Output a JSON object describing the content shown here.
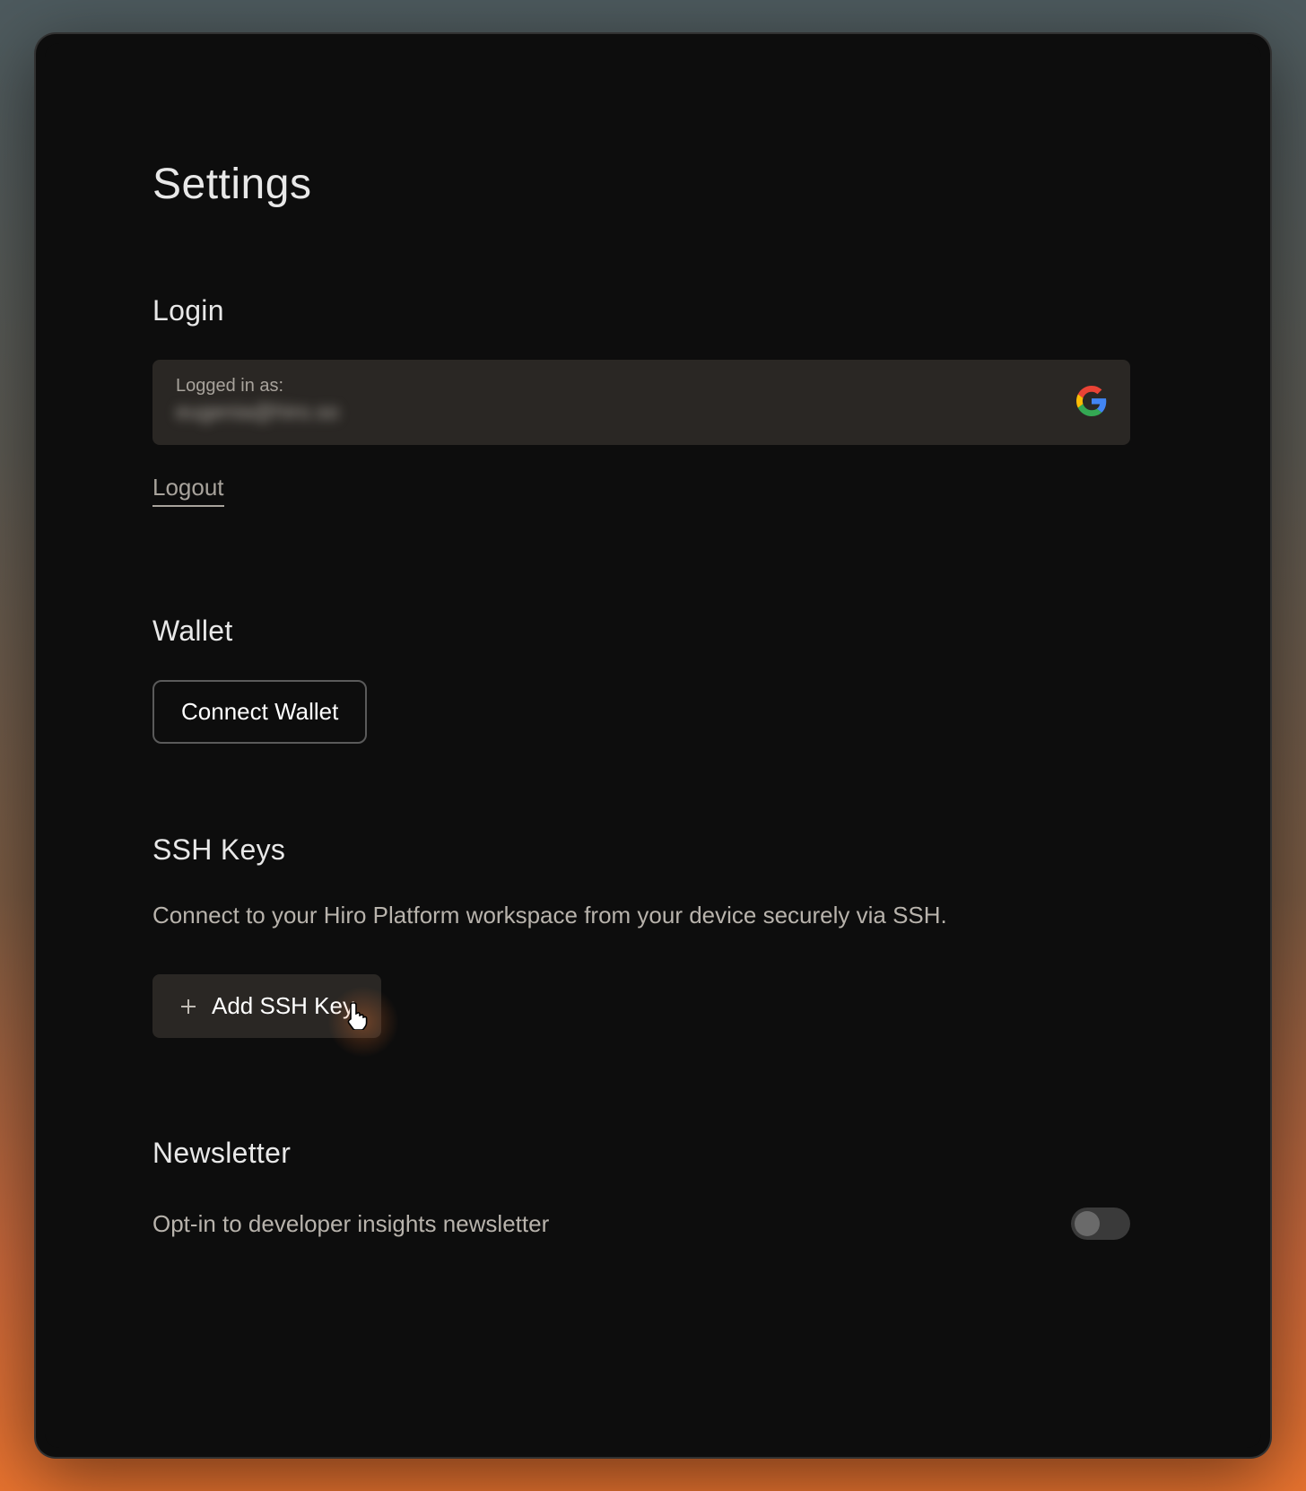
{
  "page": {
    "title": "Settings"
  },
  "login": {
    "heading": "Login",
    "label": "Logged in as:",
    "email": "eugenia@hiro.so",
    "logout": "Logout"
  },
  "wallet": {
    "heading": "Wallet",
    "connect_button": "Connect Wallet"
  },
  "ssh": {
    "heading": "SSH Keys",
    "description": "Connect to your Hiro Platform workspace from your device securely via SSH.",
    "add_button": "Add SSH Key"
  },
  "newsletter": {
    "heading": "Newsletter",
    "description": "Opt-in to developer insights newsletter",
    "toggle_on": false
  }
}
